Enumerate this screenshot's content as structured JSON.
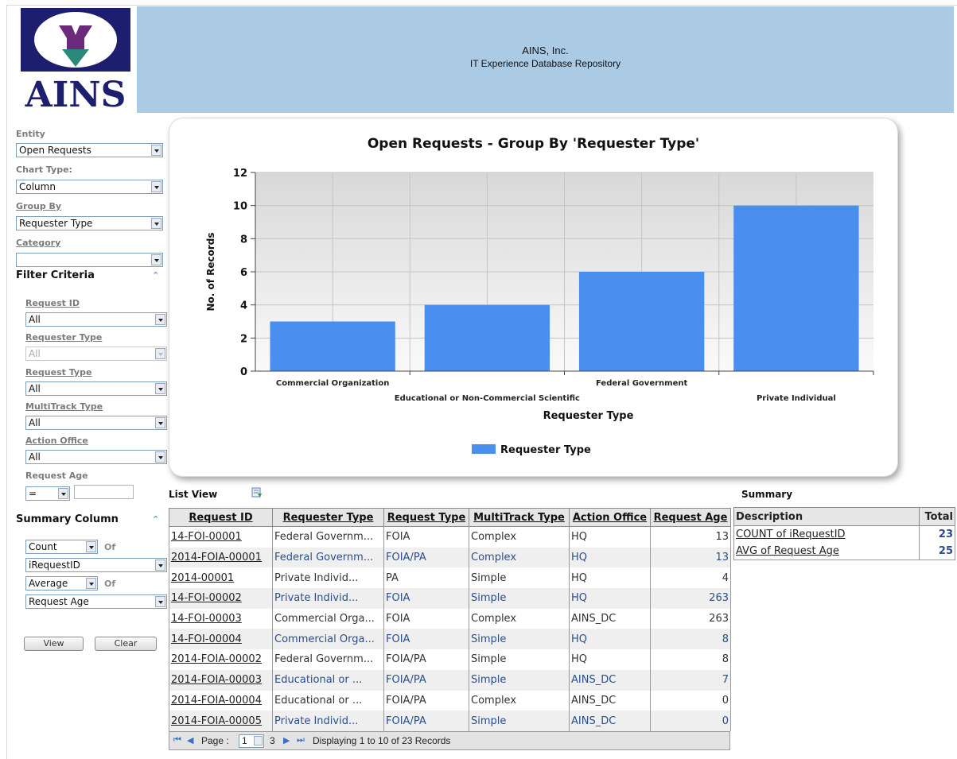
{
  "header": {
    "logo_text": "AINS",
    "company": "AINS, Inc.",
    "app_title": "IT Experience Database Repository"
  },
  "sidebar": {
    "entity_label": "Entity",
    "entity_value": "Open Requests",
    "chart_type_label": "Chart Type:",
    "chart_type_value": "Column",
    "group_by_label": "Group By",
    "group_by_value": "Requester Type",
    "category_label": "Category",
    "category_value": "",
    "filter_criteria_title": "Filter Criteria",
    "filters": {
      "request_id_label": "Request ID",
      "request_id_value": "All",
      "requester_type_label": "Requester Type",
      "requester_type_value": "All",
      "request_type_label": "Request Type",
      "request_type_value": "All",
      "multitrack_type_label": "MultiTrack Type",
      "multitrack_type_value": "All",
      "action_office_label": "Action Office",
      "action_office_value": "All",
      "request_age_label": "Request Age",
      "request_age_operator": "=",
      "request_age_value": ""
    },
    "summary_column_title": "Summary Column",
    "summary": {
      "func1": "Count",
      "of1": "Of",
      "col1": "iRequestID",
      "func2": "Average",
      "of2": "Of",
      "col2": "Request Age"
    },
    "view_button": "View",
    "clear_button": "Clear"
  },
  "chart_data": {
    "type": "bar",
    "title": "Open Requests - Group By 'Requester Type'",
    "xlabel": "Requester Type",
    "ylabel": "No. of Records",
    "categories": [
      "Commercial Organization",
      "Educational or Non-Commercial Scientific",
      "Federal Government",
      "Private Individual"
    ],
    "series": [
      {
        "name": "Requester Type",
        "values": [
          3,
          4,
          6,
          10
        ],
        "color": "#4a8ef0"
      }
    ],
    "ylim": [
      0,
      12
    ],
    "yticks": [
      0,
      2,
      4,
      6,
      8,
      10,
      12
    ],
    "grid": true,
    "legend": "bottom-center"
  },
  "list_view": {
    "title": "List View",
    "columns": [
      "Request ID",
      "Requester Type",
      "Request Type",
      "MultiTrack Type",
      "Action Office",
      "Request Age"
    ],
    "rows": [
      [
        "14-FOI-00001",
        "Federal Governm...",
        "FOIA",
        "Complex",
        "HQ",
        "13"
      ],
      [
        "2014-FOIA-00001",
        "Federal Governm...",
        "FOIA/PA",
        "Complex",
        "HQ",
        "13"
      ],
      [
        "2014-00001",
        "Private Individ...",
        "PA",
        "Simple",
        "HQ",
        "4"
      ],
      [
        "14-FOI-00002",
        "Private Individ...",
        "FOIA",
        "Simple",
        "HQ",
        "263"
      ],
      [
        "14-FOI-00003",
        "Commercial Orga...",
        "FOIA",
        "Complex",
        "AINS_DC",
        "263"
      ],
      [
        "14-FOI-00004",
        "Commercial Orga...",
        "FOIA",
        "Simple",
        "HQ",
        "8"
      ],
      [
        "2014-FOIA-00002",
        "Federal Governm...",
        "FOIA/PA",
        "Simple",
        "HQ",
        "8"
      ],
      [
        "2014-FOIA-00003",
        "Educational or ...",
        "FOIA/PA",
        "Simple",
        "AINS_DC",
        "7"
      ],
      [
        "2014-FOIA-00004",
        "Educational or ...",
        "FOIA/PA",
        "Complex",
        "AINS_DC",
        "0"
      ],
      [
        "2014-FOIA-00005",
        "Private Individ...",
        "FOIA/PA",
        "Simple",
        "AINS_DC",
        "0"
      ]
    ],
    "pager": {
      "page_label": "Page :",
      "page_value": "1",
      "total_pages": "3",
      "status": "Displaying 1 to 10 of 23 Records"
    }
  },
  "summary_table": {
    "title": "Summary",
    "columns": [
      "Description",
      "Total"
    ],
    "rows": [
      [
        "COUNT of iRequestID",
        "23"
      ],
      [
        "AVG of Request Age",
        "25"
      ]
    ]
  },
  "colors": {
    "header_band": "#abcbe5",
    "bar": "#4a8ef0",
    "logo_navy": "#1e1e6e",
    "logo_purple": "#6b2a7a",
    "logo_teal": "#2a8a7a"
  }
}
